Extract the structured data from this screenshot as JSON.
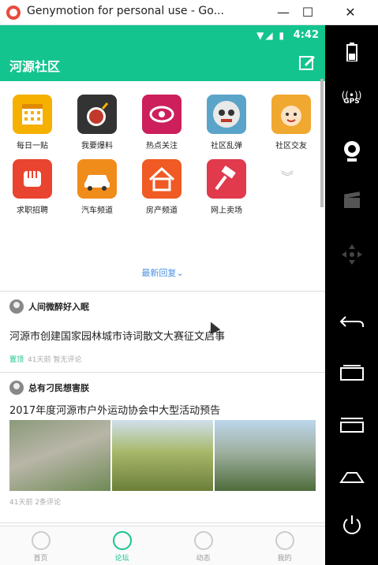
{
  "window": {
    "title": "Genymotion for personal use - Go...",
    "min": "—",
    "max": "☐",
    "close": "✕"
  },
  "statusbar": {
    "time": "4:42",
    "icons": "▼◢ ▮"
  },
  "appbar": {
    "title": "河源社区",
    "accent": "#14c48f"
  },
  "categories": [
    {
      "label": "每日一贴",
      "icon": "calendar-icon",
      "color": "#f5b000"
    },
    {
      "label": "我要爆料",
      "icon": "bomb-icon",
      "color": "#333333"
    },
    {
      "label": "热点关注",
      "icon": "eye-icon",
      "color": "#cc1f5c"
    },
    {
      "label": "社区乱弹",
      "icon": "robot-icon",
      "color": "#5ba4c9"
    },
    {
      "label": "社区交友",
      "icon": "friends-icon",
      "color": "#f0a830"
    },
    {
      "label": "求职招聘",
      "icon": "fist-icon",
      "color": "#e9442f"
    },
    {
      "label": "汽车频道",
      "icon": "car-icon",
      "color": "#f08c1a"
    },
    {
      "label": "房产频道",
      "icon": "house-icon",
      "color": "#f05a24"
    },
    {
      "label": "网上卖场",
      "icon": "gavel-icon",
      "color": "#e03a4c"
    }
  ],
  "more_chevron": "»",
  "latest_reply": "最新回复⌄",
  "posts": [
    {
      "user": "人间微醉好入眠",
      "title": "河源市创建国家园林城市诗词散文大赛征文启事",
      "tag": "置顶",
      "meta": "41天前  暂无评论"
    },
    {
      "user": "总有刁民想害朕",
      "title": "2017年度河源市户外运动协会中大型活动预告",
      "meta": "41天前  2条评论"
    }
  ],
  "tabs": [
    {
      "label": "首页"
    },
    {
      "label": "论坛"
    },
    {
      "label": "动态"
    },
    {
      "label": "我的"
    }
  ],
  "side": {
    "gps_label": "GPS"
  }
}
